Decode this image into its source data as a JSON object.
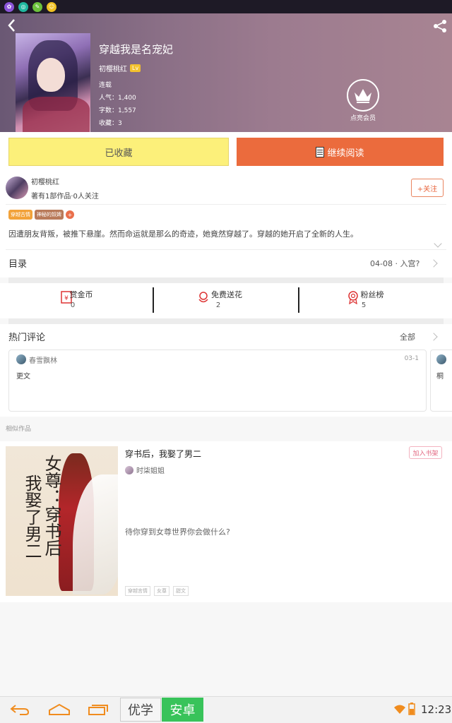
{
  "book": {
    "title": "穿越我是名宠妃",
    "author": "初樱桃红",
    "level_badge": "Lv",
    "status": "连载",
    "popularity": "人气：1,400",
    "word_count": "字数：1,557",
    "favorites": "收藏：3",
    "member_label": "点亮会员"
  },
  "actions": {
    "collected_label": "已收藏",
    "continue_label": "继续阅读"
  },
  "author_section": {
    "name": "初樱桃红",
    "meta": "著有1部作品·0人关注",
    "follow_label": "+关注",
    "tags": [
      {
        "label": "穿越古情",
        "color": "#f2a23a"
      },
      {
        "label": "神秘的奴婢",
        "color": "#b97a5a"
      }
    ],
    "tag_more": "+",
    "synopsis": "因遭朋友背叛，被推下悬崖。然而命运就是那么的奇迹，她竟然穿越了。穿越的她开启了全新的人生。"
  },
  "catalog": {
    "title": "目录",
    "latest": "04-08 · 入宫?"
  },
  "stats": [
    {
      "label": "赏金币",
      "value": "0",
      "icon": "coin-envelope-icon"
    },
    {
      "label": "免费送花",
      "value": "2",
      "icon": "flower-icon"
    },
    {
      "label": "粉丝榜",
      "value": "5",
      "icon": "medal-icon"
    }
  ],
  "comments": {
    "title": "热门评论",
    "all_label": "全部",
    "items": [
      {
        "user": "春雪飘林",
        "date": "03-1",
        "text": "更文"
      },
      {
        "user": "",
        "date": "",
        "text": "桐"
      }
    ]
  },
  "similar": {
    "section_label": "相似作品",
    "title": "穿书后，我娶了男二",
    "add_label": "加入书架",
    "author": "时柒姐姐",
    "description": "待你穿到女尊世界你会做什么?",
    "tags": [
      "穿越言情",
      "女尊",
      "甜文"
    ],
    "cover_text": [
      "女尊：穿书后",
      "我娶了男二"
    ]
  },
  "navbar": {
    "brand_left": "优学",
    "brand_right": "安卓",
    "time": "12:23"
  },
  "colors": {
    "accent_orange": "#eb6b3d",
    "collected_yellow": "#fcf07a",
    "brand_green": "#38c35a"
  }
}
